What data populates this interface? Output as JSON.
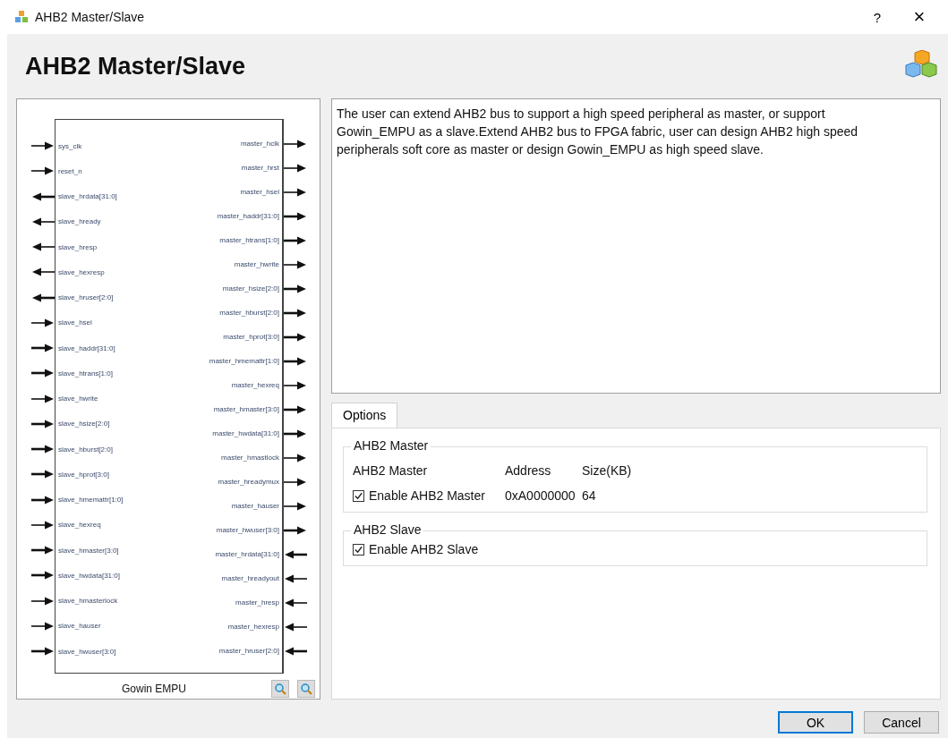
{
  "window": {
    "title": "AHB2 Master/Slave",
    "help": "?",
    "close": "×"
  },
  "header": {
    "title": "AHB2 Master/Slave"
  },
  "diagram": {
    "block_name": "Gowin EMPU",
    "left_pins": [
      {
        "name": "sys_clk",
        "output": false,
        "bus": false
      },
      {
        "name": "reset_n",
        "output": false,
        "bus": false
      },
      {
        "name": "slave_hrdata[31:0]",
        "output": true,
        "bus": true
      },
      {
        "name": "slave_hready",
        "output": true,
        "bus": false
      },
      {
        "name": "slave_hresp",
        "output": true,
        "bus": false
      },
      {
        "name": "slave_hexresp",
        "output": true,
        "bus": false
      },
      {
        "name": "slave_hruser[2:0]",
        "output": true,
        "bus": true
      },
      {
        "name": "slave_hsel",
        "output": false,
        "bus": false
      },
      {
        "name": "slave_haddr[31:0]",
        "output": false,
        "bus": true
      },
      {
        "name": "slave_htrans[1:0]",
        "output": false,
        "bus": true
      },
      {
        "name": "slave_hwrite",
        "output": false,
        "bus": false
      },
      {
        "name": "slave_hsize[2:0]",
        "output": false,
        "bus": true
      },
      {
        "name": "slave_hburst[2:0]",
        "output": false,
        "bus": true
      },
      {
        "name": "slave_hprot[3:0]",
        "output": false,
        "bus": true
      },
      {
        "name": "slave_hmemattr[1:0]",
        "output": false,
        "bus": true
      },
      {
        "name": "slave_hexreq",
        "output": false,
        "bus": false
      },
      {
        "name": "slave_hmaster[3:0]",
        "output": false,
        "bus": true
      },
      {
        "name": "slave_hwdata[31:0]",
        "output": false,
        "bus": true
      },
      {
        "name": "slave_hmasterlock",
        "output": false,
        "bus": false
      },
      {
        "name": "slave_hauser",
        "output": false,
        "bus": false
      },
      {
        "name": "slave_hwuser[3:0]",
        "output": false,
        "bus": true
      }
    ],
    "right_pins": [
      {
        "name": "master_hclk",
        "output": true,
        "bus": false
      },
      {
        "name": "master_hrst",
        "output": true,
        "bus": false
      },
      {
        "name": "master_hsel",
        "output": true,
        "bus": false
      },
      {
        "name": "master_haddr[31:0]",
        "output": true,
        "bus": true
      },
      {
        "name": "master_htrans[1:0]",
        "output": true,
        "bus": true
      },
      {
        "name": "master_hwrite",
        "output": true,
        "bus": false
      },
      {
        "name": "master_hsize[2:0]",
        "output": true,
        "bus": true
      },
      {
        "name": "master_hburst[2:0]",
        "output": true,
        "bus": true
      },
      {
        "name": "master_hprot[3:0]",
        "output": true,
        "bus": true
      },
      {
        "name": "master_hmemattr[1:0]",
        "output": true,
        "bus": true
      },
      {
        "name": "master_hexreq",
        "output": true,
        "bus": false
      },
      {
        "name": "master_hmaster[3:0]",
        "output": true,
        "bus": true
      },
      {
        "name": "master_hwdata[31:0]",
        "output": true,
        "bus": true
      },
      {
        "name": "master_hmastlock",
        "output": true,
        "bus": false
      },
      {
        "name": "master_hreadymux",
        "output": true,
        "bus": false
      },
      {
        "name": "master_hauser",
        "output": true,
        "bus": false
      },
      {
        "name": "master_hwuser[3:0]",
        "output": true,
        "bus": true
      },
      {
        "name": "master_hrdata[31:0]",
        "output": false,
        "bus": true
      },
      {
        "name": "master_hreadyout",
        "output": false,
        "bus": false
      },
      {
        "name": "master_hresp",
        "output": false,
        "bus": false
      },
      {
        "name": "master_hexresp",
        "output": false,
        "bus": false
      },
      {
        "name": "master_hruser[2:0]",
        "output": false,
        "bus": true
      }
    ]
  },
  "description": "The user can extend AHB2 bus to support a high speed peripheral as master, or support Gowin_EMPU as a slave.Extend AHB2 bus to FPGA fabric, user can design AHB2 high speed peripherals soft core as master or design Gowin_EMPU as high speed slave.",
  "tabs": [
    {
      "label": "Options",
      "selected": true
    }
  ],
  "master_group": {
    "title": "AHB2 Master",
    "columns": [
      "AHB2 Master",
      "Address",
      "Size(KB)"
    ],
    "checkbox": {
      "label": "Enable AHB2 Master",
      "checked": true
    },
    "address": "0xA0000000",
    "size": "64"
  },
  "slave_group": {
    "title": "AHB2 Slave",
    "checkbox": {
      "label": "Enable AHB2 Slave",
      "checked": true
    }
  },
  "buttons": [
    {
      "label": "OK",
      "kind": "default"
    },
    {
      "label": "Cancel",
      "kind": "normal"
    }
  ]
}
